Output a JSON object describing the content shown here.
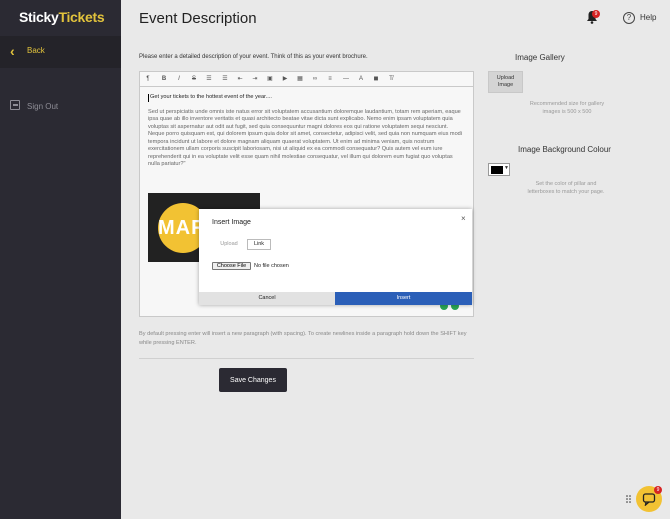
{
  "brand": {
    "sticky": "Sticky",
    "tickets": "Tickets"
  },
  "sidebar": {
    "back_label": "Back",
    "signout_label": "Sign Out"
  },
  "header": {
    "title": "Event Description",
    "notification_count": "9",
    "help_label": "Help"
  },
  "main": {
    "intro": "Please enter a detailed description of your event. Think of this as your event brochure.",
    "editor": {
      "first_line": "Get your tickets to the hottest event of the year....",
      "paragraph": "Sed ut perspiciatis unde omnis iste natus error sit voluptatem accusantium doloremque laudantium, totam rem aperiam, eaque ipsa quae ab illo inventore veritatis et quasi architecto beatae vitae dicta sunt explicabo. Nemo enim ipsam voluptatem quia voluptas sit aspernatur aut odit aut fugit, sed quia consequuntur magni dolores eos qui ratione voluptatem sequi nesciunt. Neque porro quisquam est, qui dolorem ipsum quia dolor sit amet, consectetur, adipisci velit, sed quia non numquam eius modi tempora incidunt ut labore et dolore magnam aliquam quaerat voluptatem. Ut enim ad minima veniam, quis nostrum exercitationem ullam corporis suscipit laboriosam, nisi ut aliquid ex ea commodi consequatur? Quis autem vel eum iure reprehenderit qui in ea voluptate velit esse quam nihil molestiae consequatur, vel illum qui dolorem eum fugiat quo voluptas nulla pariatur?\"",
      "image_text": "MAR"
    },
    "note": "By default pressing enter will insert a new paragraph (with spacing). To create newlines inside a paragraph hold down the SHIFT key while pressing ENTER.",
    "save_label": "Save Changes"
  },
  "right": {
    "gallery_title": "Image Gallery",
    "upload_label": "Upload Image",
    "gallery_note": "Recommended size for gallery images is 500 x 500",
    "bg_title": "Image Background Colour",
    "bg_color": "#000000",
    "bg_note": "Set the color of pillar and letterboxes to match your page."
  },
  "modal": {
    "title": "Insert Image",
    "close": "×",
    "tab_upload": "Upload",
    "tab_link": "Link",
    "choose_file": "Choose File",
    "no_file": "No file chosen",
    "cancel": "Cancel",
    "insert": "Insert"
  },
  "chat": {
    "badge": "9"
  },
  "colors": {
    "sidebar": "#2b2a33",
    "accent": "#e2c33c",
    "insert": "#2b5fb8",
    "badge": "#d62424"
  }
}
